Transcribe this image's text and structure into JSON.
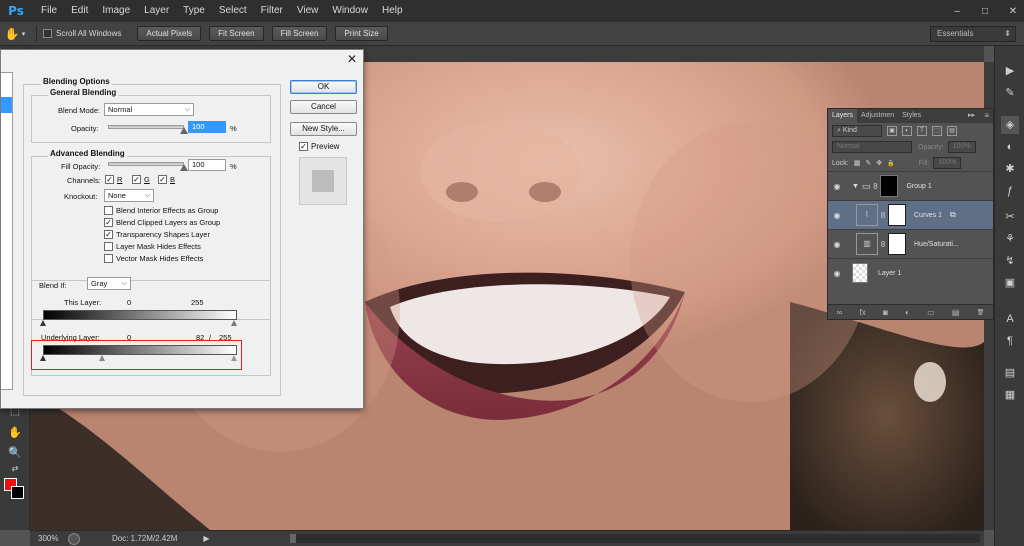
{
  "app": {
    "logo_text": "Ps"
  },
  "menu": [
    "File",
    "Edit",
    "Image",
    "Layer",
    "Type",
    "Select",
    "Filter",
    "View",
    "Window",
    "Help"
  ],
  "window_controls": {
    "minimize": "–",
    "maximize": "□",
    "close": "✕"
  },
  "options_bar": {
    "hand_glyph": "✋",
    "dropdown_glyph": "▾",
    "scroll_all_windows": "Scroll All Windows",
    "scroll_all_checked": false,
    "buttons": [
      "Actual Pixels",
      "Fit Screen",
      "Fill Screen",
      "Print Size"
    ],
    "workspace": "Essentials"
  },
  "dialog": {
    "close_glyph": "✕",
    "section_title": "Blending Options",
    "general": {
      "title": "General Blending",
      "blend_mode_label": "Blend Mode:",
      "blend_mode_value": "Normal",
      "opacity_label": "Opacity:",
      "opacity_value": "100",
      "opacity_fraction": 1.0,
      "percent": "%"
    },
    "advanced": {
      "title": "Advanced Blending",
      "fill_opacity_label": "Fill Opacity:",
      "fill_opacity_value": "100",
      "fill_opacity_fraction": 1.0,
      "percent": "%",
      "channels_label": "Channels:",
      "channels": [
        {
          "label": "R",
          "checked": true
        },
        {
          "label": "G",
          "checked": true
        },
        {
          "label": "B",
          "checked": true
        }
      ],
      "knockout_label": "Knockout:",
      "knockout_value": "None",
      "options": [
        {
          "label": "Blend Interior Effects as Group",
          "checked": false
        },
        {
          "label": "Blend Clipped Layers as Group",
          "checked": true
        },
        {
          "label": "Transparency Shapes Layer",
          "checked": true
        },
        {
          "label": "Layer Mask Hides Effects",
          "checked": false
        },
        {
          "label": "Vector Mask Hides Effects",
          "checked": false
        }
      ]
    },
    "blend_if": {
      "label": "Blend If:",
      "value": "Gray",
      "this_layer_label": "This Layer:",
      "this_layer_low": "0",
      "this_layer_high": "255",
      "underlying_label": "Underlying Layer:",
      "underlying_low": "0",
      "underlying_split": "82",
      "underlying_sep": "/",
      "underlying_high": "255"
    },
    "buttons": {
      "ok": "OK",
      "cancel": "Cancel",
      "new_style": "New Style...",
      "preview": "Preview",
      "preview_checked": true
    }
  },
  "layers_panel": {
    "tabs": [
      "Layers",
      "Adjustmen",
      "Styles"
    ],
    "collapse_glyph": "▸▸",
    "menu_glyph": "≡",
    "filter_value": "Kind",
    "filter_glyphs": [
      "▣",
      "◐",
      "T",
      "⬚",
      "▤"
    ],
    "blend_mode": "Normal",
    "opacity_label": "Opacity:",
    "opacity_value": "100%",
    "lock_label": "Lock:",
    "lock_glyphs": [
      "▦",
      "✎",
      "✥",
      "🔒"
    ],
    "fill_label": "Fill:",
    "fill_value": "100%",
    "layers": [
      {
        "name": "Group 1",
        "type": "group",
        "selected": false
      },
      {
        "name": "Curves 1",
        "type": "curves",
        "selected": true
      },
      {
        "name": "Hue/Saturati...",
        "type": "huesat",
        "selected": false
      },
      {
        "name": "Layer 1",
        "type": "pixel",
        "selected": false
      }
    ],
    "eye_glyph": "◉",
    "chain_glyph": "8",
    "bottom_glyphs": [
      "∞",
      "fx",
      "◙",
      "◐",
      "▭",
      "▤",
      "🗑"
    ]
  },
  "status_bar": {
    "zoom": "300%",
    "doc_size": "Doc: 1.72M/2.42M",
    "arrow_glyph": "▶"
  },
  "toolbar_glyphs": [
    "⬚",
    "✋",
    "🔍",
    "⇄"
  ],
  "colors": {
    "foreground": "#ee1010",
    "background": "#000000",
    "highlight_box": "#e02020",
    "selected_layer": "#5f6f86"
  }
}
